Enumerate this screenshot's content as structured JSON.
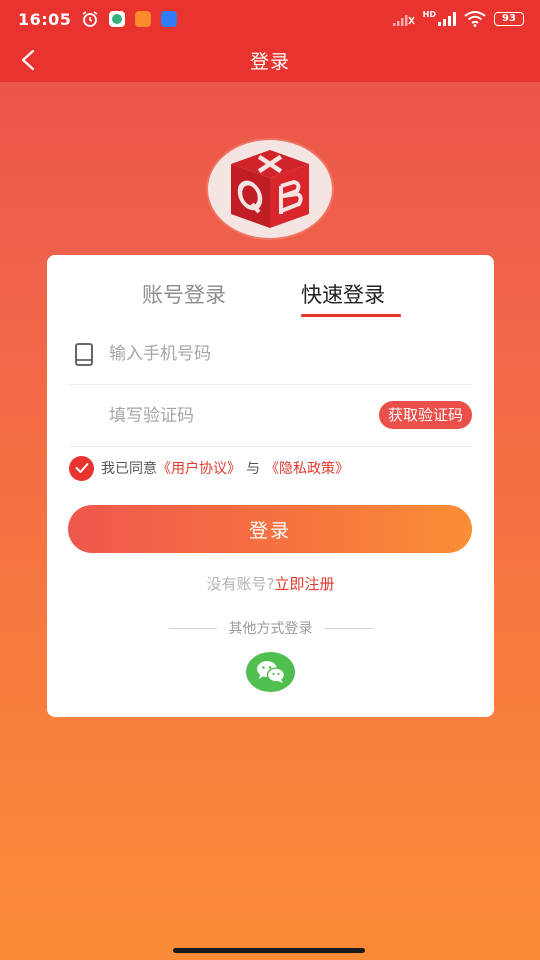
{
  "status_bar": {
    "time": "16:05",
    "battery": "93",
    "network_label": "HD"
  },
  "nav": {
    "title": "登录"
  },
  "tabs": {
    "account_login": "账号登录",
    "quick_login": "快速登录",
    "active": "quick_login"
  },
  "form": {
    "phone_placeholder": "输入手机号码",
    "phone_value": "",
    "code_placeholder": "填写验证码",
    "code_value": "",
    "get_code_label": "获取验证码"
  },
  "agreement": {
    "checked": true,
    "prefix": "我已同意",
    "user_agreement": "《用户协议》",
    "and": "与",
    "privacy_policy": "《隐私政策》"
  },
  "login_button": "登录",
  "register": {
    "hint": "没有账号?",
    "link": "立即注册"
  },
  "other_login": {
    "label": "其他方式登录",
    "methods": [
      "wechat-icon"
    ]
  },
  "colors": {
    "brand_red": "#e8332f",
    "gradient_start": "#ee574d",
    "gradient_end": "#fa8e35",
    "wechat_green": "#4fc04f",
    "link_red": "#e03a2f"
  }
}
